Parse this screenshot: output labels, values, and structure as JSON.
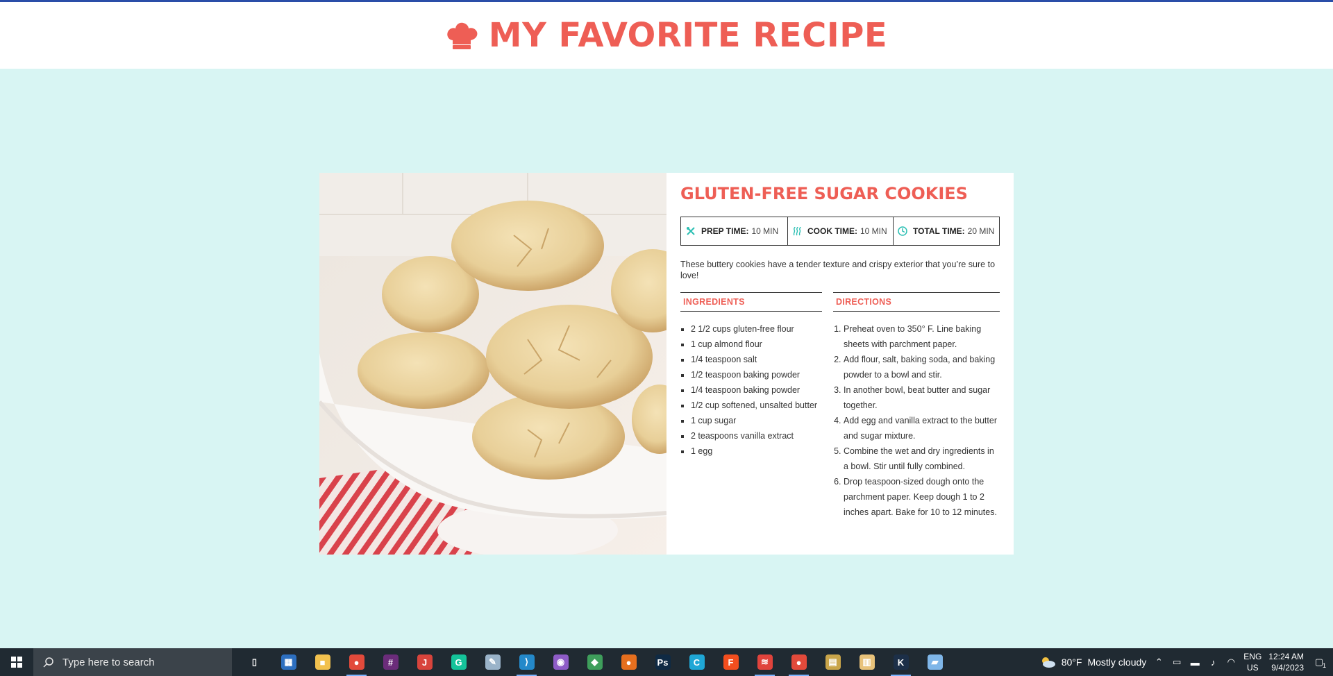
{
  "header": {
    "title": "MY FAVORITE RECIPE",
    "icon": "chef-hat-icon"
  },
  "recipe": {
    "title": "GLUTEN-FREE SUGAR COOKIES",
    "times": [
      {
        "icon": "utensils-icon",
        "label": "PREP TIME:",
        "value": "10 MIN"
      },
      {
        "icon": "heat-waves-icon",
        "label": "COOK TIME:",
        "value": "10 MIN"
      },
      {
        "icon": "clock-icon",
        "label": "TOTAL TIME:",
        "value": "20 MIN"
      }
    ],
    "description": "These buttery cookies have a tender texture and crispy exterior that you’re sure to love!",
    "ingredients_heading": "INGREDIENTS",
    "ingredients": [
      "2 1/2 cups gluten-free flour",
      "1 cup almond flour",
      "1/4 teaspoon salt",
      "1/2 teaspoon baking powder",
      "1/4 teaspoon baking powder",
      "1/2 cup softened, unsalted butter",
      "1 cup sugar",
      "2 teaspoons vanilla extract",
      "1 egg"
    ],
    "directions_heading": "DIRECTIONS",
    "directions": [
      "Preheat oven to 350° F. Line baking sheets with parchment paper.",
      "Add flour, salt, baking soda, and baking powder to a bowl and stir.",
      "In another bowl, beat butter and sugar together.",
      "Add egg and vanilla extract to the butter and sugar mixture.",
      "Combine the wet and dry ingredients in a bowl. Stir until fully combined.",
      "Drop teaspoon-sized dough onto the parchment paper. Keep dough 1 to 2 inches apart. Bake for 10 to 12 minutes."
    ]
  },
  "colors": {
    "accent": "#ee5e55",
    "background": "#d8f5f3",
    "teal_icon": "#2bbfb3"
  },
  "taskbar": {
    "search_placeholder": "Type here to search",
    "apps": [
      {
        "name": "task-view-icon",
        "color": "#202a32",
        "glyph": "▯"
      },
      {
        "name": "calculator-icon",
        "color": "#2d6fbf",
        "glyph": "▦"
      },
      {
        "name": "file-explorer-icon",
        "color": "#f2c14e",
        "glyph": "■"
      },
      {
        "name": "chrome-icon",
        "color": "#e24a3b",
        "glyph": "●"
      },
      {
        "name": "slack-icon",
        "color": "#6b2c7a",
        "glyph": "#"
      },
      {
        "name": "app-icon",
        "color": "#d8443c",
        "glyph": "J"
      },
      {
        "name": "grammarly-icon",
        "color": "#15c39a",
        "glyph": "G"
      },
      {
        "name": "paint-icon",
        "color": "#9ab3c9",
        "glyph": "✎"
      },
      {
        "name": "vscode-icon",
        "color": "#2489ca",
        "glyph": "⟩"
      },
      {
        "name": "github-icon",
        "color": "#8e5cc7",
        "glyph": "◉"
      },
      {
        "name": "git-icon",
        "color": "#3e9e5b",
        "glyph": "◆"
      },
      {
        "name": "firefox-icon",
        "color": "#e66f1e",
        "glyph": "●"
      },
      {
        "name": "photoshop-icon",
        "color": "#0f2a44",
        "glyph": "Ps"
      },
      {
        "name": "canva-icon",
        "color": "#1fa7d6",
        "glyph": "C"
      },
      {
        "name": "figma-icon",
        "color": "#f24e1e",
        "glyph": "F"
      },
      {
        "name": "app-red-icon",
        "color": "#e0433c",
        "glyph": "≋"
      },
      {
        "name": "chrome-profile-icon",
        "color": "#e24a3b",
        "glyph": "●"
      },
      {
        "name": "file-manager-icon",
        "color": "#c9a54a",
        "glyph": "▤"
      },
      {
        "name": "file-icon",
        "color": "#e8c27a",
        "glyph": "▥"
      },
      {
        "name": "keystroke-icon",
        "color": "#1c2f48",
        "glyph": "K"
      },
      {
        "name": "notes-icon",
        "color": "#7fb6e8",
        "glyph": "▰"
      }
    ],
    "weather_temp": "80°F",
    "weather_text": "Mostly cloudy",
    "lang_top": "ENG",
    "lang_bottom": "US",
    "time": "12:24 AM",
    "date": "9/4/2023",
    "notification_count": "1"
  }
}
